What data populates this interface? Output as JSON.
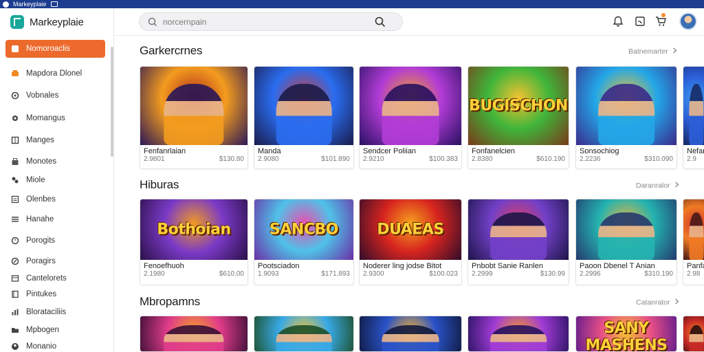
{
  "window": {
    "title": "Markeyplaie"
  },
  "brand": {
    "name": "Markeyplaie"
  },
  "search": {
    "placeholder": "norcernpain"
  },
  "nav": [
    {
      "label": "Nomoroaclis",
      "icon": "home-icon",
      "active": true
    },
    {
      "label": "Mapdora Dlonel",
      "icon": "gamepad-icon"
    },
    {
      "label": "Vobnales",
      "icon": "circle-icon"
    },
    {
      "label": "Momangus",
      "icon": "gear-icon"
    },
    {
      "label": "Manges",
      "icon": "grid-icon"
    },
    {
      "label": "Monotes",
      "icon": "tag-icon"
    },
    {
      "label": "Miole",
      "icon": "puzzle-icon"
    },
    {
      "label": "Olenbes",
      "icon": "list-icon"
    },
    {
      "label": "Hanahe",
      "icon": "menu-icon"
    },
    {
      "label": "Porogits",
      "icon": "clock-icon"
    },
    {
      "label": "Poragirs",
      "icon": "pencil-icon"
    },
    {
      "label": "Cantelorets",
      "icon": "table-icon"
    },
    {
      "label": "Pintukes",
      "icon": "book-icon"
    },
    {
      "label": "Blorataciliis",
      "icon": "chart-icon"
    },
    {
      "label": "Mpbogen",
      "icon": "folder-icon"
    },
    {
      "label": "Monanio",
      "icon": "user-icon"
    }
  ],
  "sections": [
    {
      "title": "Garkercrnes",
      "see_all": "Batnemarter",
      "cards": [
        {
          "name": "Fenfanrlaian",
          "left": "2.9801",
          "right": "$130.80",
          "art": "",
          "palette": [
            "#f39c1e",
            "#b02c1a",
            "#2a1656"
          ]
        },
        {
          "name": "Manda",
          "left": "2.9080",
          "right": "$101.890",
          "art": "",
          "palette": [
            "#2a6df0",
            "#d23b32",
            "#1a1b4a"
          ]
        },
        {
          "name": "Sendcer Poliian",
          "left": "2.9210",
          "right": "$100.383",
          "art": "",
          "palette": [
            "#b23cd6",
            "#f2a21c",
            "#281060"
          ]
        },
        {
          "name": "Fonfanelcien",
          "left": "2.8380",
          "right": "$610.190",
          "art": "BUGISCHON",
          "palette": [
            "#3fb53a",
            "#f5c231",
            "#7a3a1a"
          ]
        },
        {
          "name": "Sonsochiog",
          "left": "2.2236",
          "right": "$310.090",
          "art": "",
          "palette": [
            "#23a7e8",
            "#f1c12c",
            "#3a2a8a"
          ]
        },
        {
          "name": "Nefan",
          "left": "2.9",
          "right": "",
          "art": "",
          "palette": [
            "#2b5ed8",
            "#3c9af0",
            "#162a66"
          ]
        }
      ]
    },
    {
      "title": "Hiburas",
      "see_all": "Daranralor",
      "cards": [
        {
          "name": "Fenoefhuoh",
          "left": "2.1980",
          "right": "$610.00",
          "art": "Bothoian",
          "palette": [
            "#7b3ac7",
            "#f09a22",
            "#2a1048"
          ]
        },
        {
          "name": "Pootsciadon",
          "left": "1.9093",
          "right": "$171.893",
          "art": "SANCBO",
          "palette": [
            "#4fc2e8",
            "#e94fb0",
            "#6b2fa6"
          ]
        },
        {
          "name": "Noderer ling jodse Bitot",
          "left": "2.9300",
          "right": "$100.023",
          "art": "DUAEAS",
          "palette": [
            "#d7241f",
            "#f6a21d",
            "#300d2a"
          ]
        },
        {
          "name": "Pnbobt Sanie Ranlen",
          "left": "2.2999",
          "right": "$130.99",
          "art": "",
          "palette": [
            "#7240c8",
            "#e23d5e",
            "#1d1548"
          ]
        },
        {
          "name": "Paoon Dbenel T Anian",
          "left": "2.2996",
          "right": "$310.190",
          "art": "",
          "palette": [
            "#24b3b0",
            "#f0b43a",
            "#243a6e"
          ]
        },
        {
          "name": "Panfa",
          "left": "2.98",
          "right": "",
          "art": "",
          "palette": [
            "#f07a24",
            "#d1342a",
            "#4a1a18"
          ]
        }
      ]
    },
    {
      "title": "Mbropamns",
      "see_all": "Catanrator",
      "cards": [
        {
          "name": "",
          "left": "",
          "right": "",
          "art": "",
          "palette": [
            "#e13c8a",
            "#f4a521",
            "#3a0f36"
          ]
        },
        {
          "name": "",
          "left": "",
          "right": "",
          "art": "",
          "palette": [
            "#38a9e6",
            "#f2c23a",
            "#1d4f2a"
          ]
        },
        {
          "name": "",
          "left": "",
          "right": "",
          "art": "",
          "palette": [
            "#2a53c8",
            "#f3b02f",
            "#101a40"
          ]
        },
        {
          "name": "",
          "left": "",
          "right": "",
          "art": "",
          "palette": [
            "#a13cd6",
            "#f29b21",
            "#281260"
          ]
        },
        {
          "name": "",
          "left": "",
          "right": "",
          "art": "SANY MASHENS",
          "palette": [
            "#e84f87",
            "#f6c42f",
            "#5b1a8a"
          ]
        },
        {
          "name": "",
          "left": "",
          "right": "",
          "art": "",
          "palette": [
            "#c82a26",
            "#f08a22",
            "#2a0e10"
          ]
        }
      ]
    }
  ]
}
